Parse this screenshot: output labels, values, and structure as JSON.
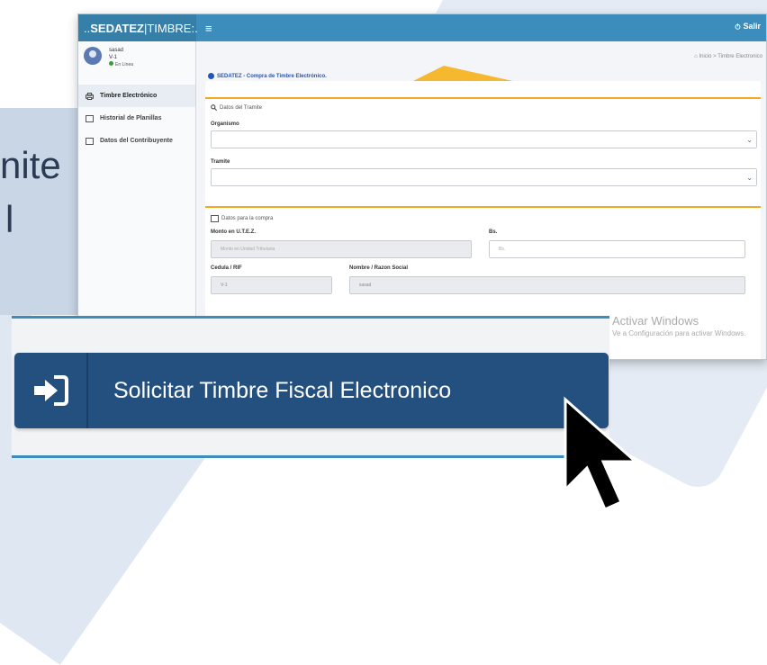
{
  "background": {
    "partial_text_lines": [
      "nite",
      "l"
    ]
  },
  "app": {
    "brand_prefix": "..",
    "brand_bold": "SEDATEZ",
    "brand_sep": "|",
    "brand_rest": "TIMBRE:.",
    "menu_toggle": "≡",
    "logout_label": "Salir",
    "user": {
      "name": "sasad",
      "id": "V-1",
      "status": "En Línea"
    },
    "sidebar": {
      "items": [
        {
          "label": "Timbre Electrónico",
          "active": true
        },
        {
          "label": "Historial de Planillas",
          "active": false
        },
        {
          "label": "Datos del Contribuyente",
          "active": false
        }
      ]
    },
    "breadcrumb": {
      "home": "Inicio",
      "sep": ">",
      "current": "Timbre Electronico"
    },
    "card_title": "SEDATEZ - Compra de Timbre Electrónico.",
    "tramite_section": {
      "heading": "Datos del Tramite",
      "organismo_label": "Organismo",
      "tramite_label": "Tramite"
    },
    "compra_section": {
      "heading": "Datos para la compra",
      "monto_label": "Monto en U.T.E.Z.",
      "monto_placeholder": "Monto en Unidad Tributaria",
      "bs_label": "Bs.",
      "bs_placeholder": "Bs.",
      "cedula_label": "Cedula / RIF",
      "cedula_value": "V-1",
      "nombre_label": "Nombre / Razon Social",
      "nombre_value": "sasad"
    }
  },
  "zoom_panel": {
    "button_label": "Solicitar Timbre Fiscal Electronico"
  },
  "windows_watermark": {
    "title": "Activar Windows",
    "subtitle": "Ve a Configuración para activar Windows."
  },
  "colors": {
    "topbar": "#3c8dbc",
    "accent_orange": "#f5a623",
    "button_blue": "#24507f"
  }
}
